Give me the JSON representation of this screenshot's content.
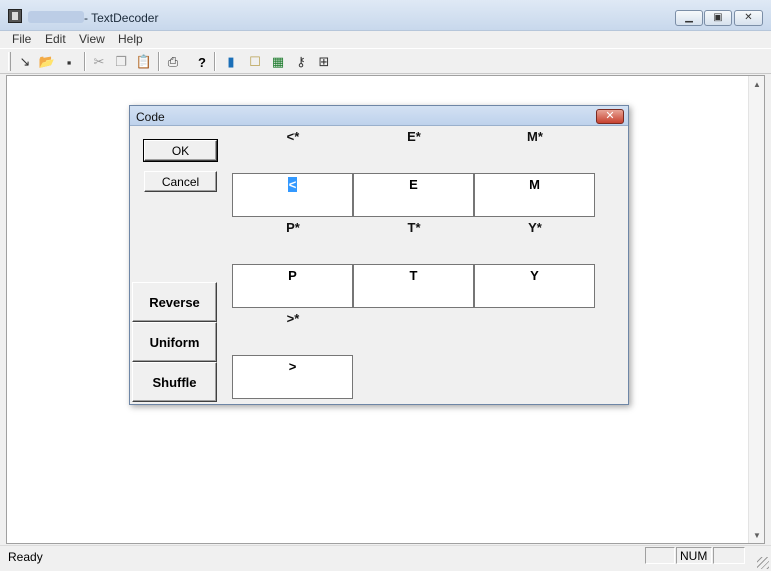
{
  "window": {
    "title": "- TextDecoder"
  },
  "menu": [
    "File",
    "Edit",
    "View",
    "Help"
  ],
  "toolbar": {
    "icons": [
      "new-icon",
      "open-icon",
      "save-icon",
      "cut-icon",
      "copy-icon",
      "paste-icon",
      "print-icon",
      "help-icon",
      "book-icon",
      "scroll-icon",
      "chip-icon",
      "key-icon",
      "grid-icon"
    ]
  },
  "status": {
    "text": "Ready",
    "num": "NUM"
  },
  "dialog": {
    "title": "Code",
    "close": "✕",
    "ok": "OK",
    "cancel": "Cancel",
    "reverse": "Reverse",
    "uniform": "Uniform",
    "shuffle": "Shuffle",
    "slots": [
      {
        "label": "<*",
        "value": "<",
        "selected": true
      },
      {
        "label": "E*",
        "value": "E"
      },
      {
        "label": "M*",
        "value": "M"
      },
      {
        "label": "P*",
        "value": "P"
      },
      {
        "label": "T*",
        "value": "T"
      },
      {
        "label": "Y*",
        "value": "Y"
      },
      {
        "label": ">*",
        "value": ">"
      }
    ]
  }
}
